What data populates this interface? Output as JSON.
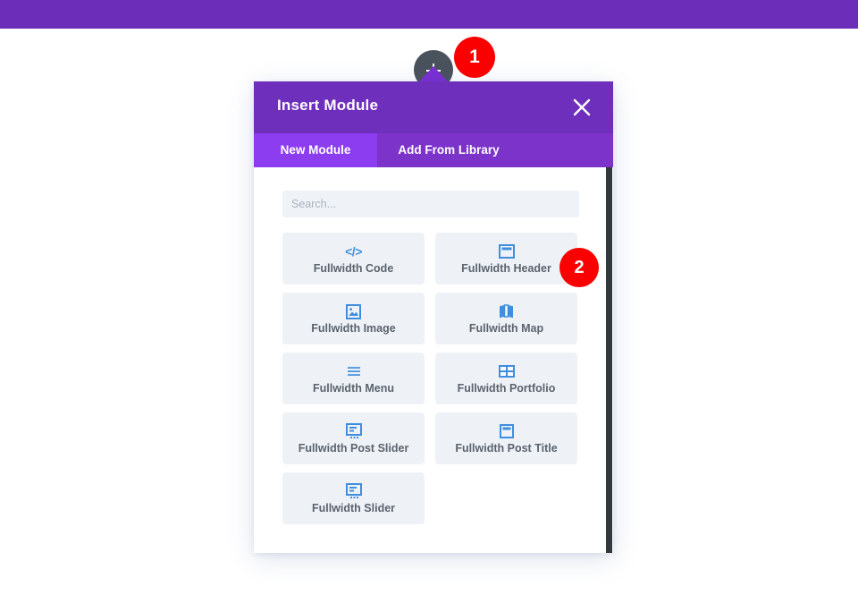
{
  "page": {
    "admin_bar_color": "#6c2eb9",
    "background_color": "#ffffff"
  },
  "add_module_button": {
    "icon": "plus-icon",
    "color": "#4a525c"
  },
  "step_badges": [
    {
      "label": "1",
      "color": "#fa0000"
    },
    {
      "label": "2",
      "color": "#fa0000"
    }
  ],
  "modal": {
    "title": "Insert Module",
    "header_color": "#6f2fbd",
    "close_icon": "close-icon",
    "tabs": [
      {
        "label": "New Module",
        "active": true,
        "color": "#8c3df0"
      },
      {
        "label": "Add From Library",
        "active": false,
        "color": "#7b33ca"
      }
    ],
    "search": {
      "value": "",
      "placeholder": "Search..."
    },
    "modules": [
      {
        "label": "Fullwidth Code",
        "icon": "code-icon"
      },
      {
        "label": "Fullwidth Header",
        "icon": "header-icon"
      },
      {
        "label": "Fullwidth Image",
        "icon": "image-icon"
      },
      {
        "label": "Fullwidth Map",
        "icon": "map-icon"
      },
      {
        "label": "Fullwidth Menu",
        "icon": "menu-icon"
      },
      {
        "label": "Fullwidth Portfolio",
        "icon": "portfolio-grid-icon"
      },
      {
        "label": "Fullwidth Post Slider",
        "icon": "post-slider-icon"
      },
      {
        "label": "Fullwidth Post Title",
        "icon": "post-title-icon"
      },
      {
        "label": "Fullwidth Slider",
        "icon": "slider-icon"
      }
    ],
    "scrollbar": {
      "color": "#33383d"
    },
    "icon_color": "#3f8fe0"
  }
}
